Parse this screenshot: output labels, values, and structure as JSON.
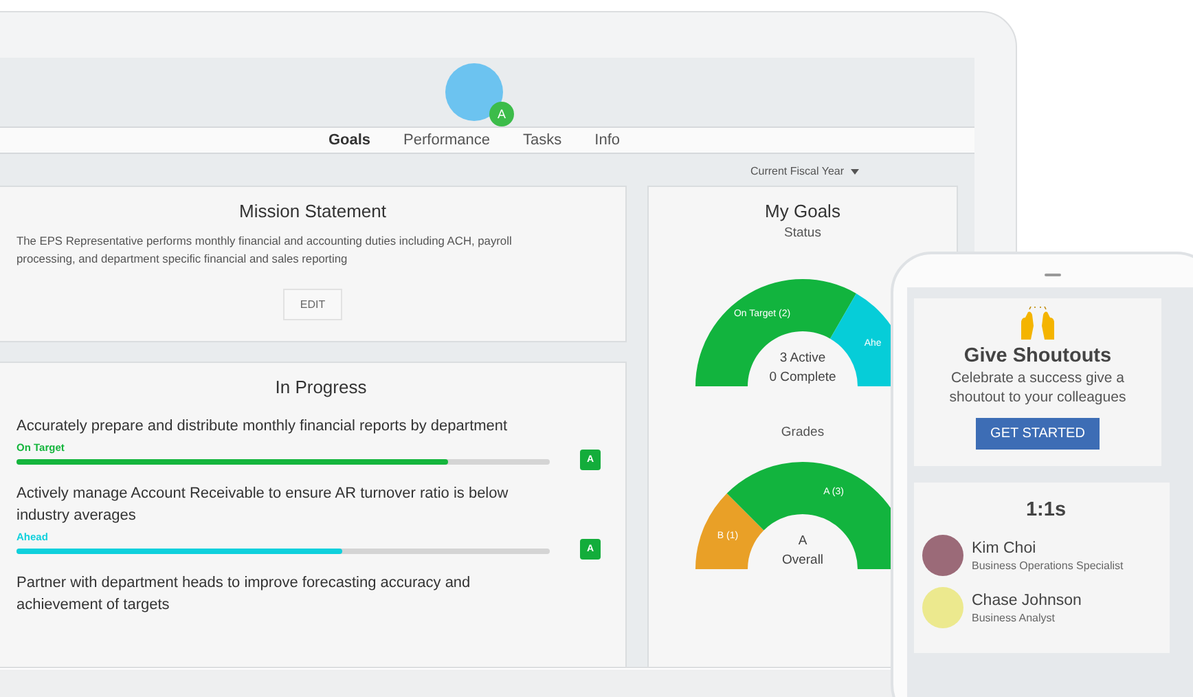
{
  "profile": {
    "badge": "A"
  },
  "tabs": [
    {
      "label": "Goals",
      "selected": true
    },
    {
      "label": "Performance",
      "selected": false
    },
    {
      "label": "Tasks",
      "selected": false
    },
    {
      "label": "Info",
      "selected": false
    }
  ],
  "period_filter": {
    "label": "Current Fiscal Year"
  },
  "mission": {
    "title": "Mission Statement",
    "text": "The EPS Representative performs monthly financial and accounting duties including ACH, payroll processing, and department specific financial and sales reporting",
    "button": "EDIT"
  },
  "in_progress": {
    "title": "In Progress",
    "goals": [
      {
        "title": "Accurately prepare and distribute monthly financial reports by department",
        "status": "On Target",
        "color": "#14b53c",
        "level": 0.81,
        "grade": "A"
      },
      {
        "title": "Actively manage Account Receivable to ensure AR turnover ratio is below industry averages",
        "status": "Ahead",
        "color": "#0fd0dc",
        "level": 0.61,
        "grade": "A"
      },
      {
        "title": "Partner with department heads to improve forecasting accuracy and achievement of targets"
      }
    ]
  },
  "my_goals": {
    "title": "My Goals",
    "charts": [
      {
        "subtitle": "Status",
        "center": [
          "3 Active",
          "0 Complete"
        ],
        "chart_data": {
          "type": "donut",
          "categories": [
            "On Target (2)",
            "Ahe"
          ],
          "values": [
            2,
            1
          ],
          "colors": [
            "#12b43e",
            "#06cdd8"
          ]
        }
      },
      {
        "subtitle": "Grades",
        "center": [
          "A",
          "Overall"
        ],
        "chart_data": {
          "type": "donut",
          "categories": [
            "B (1)",
            "A (3)"
          ],
          "values": [
            1,
            3
          ],
          "colors": [
            "#e9a027",
            "#12b43e"
          ]
        }
      }
    ]
  },
  "phone": {
    "shoutouts": {
      "title": "Give Shoutouts",
      "text": "Celebrate a success give a shoutout to your colleagues",
      "button": "GET STARTED"
    },
    "one_on_ones": {
      "title": "1:1s",
      "people": [
        {
          "name": "Kim Choi",
          "role": "Business Operations Specialist"
        },
        {
          "name": "Chase Johnson",
          "role": "Business Analyst"
        }
      ]
    }
  }
}
